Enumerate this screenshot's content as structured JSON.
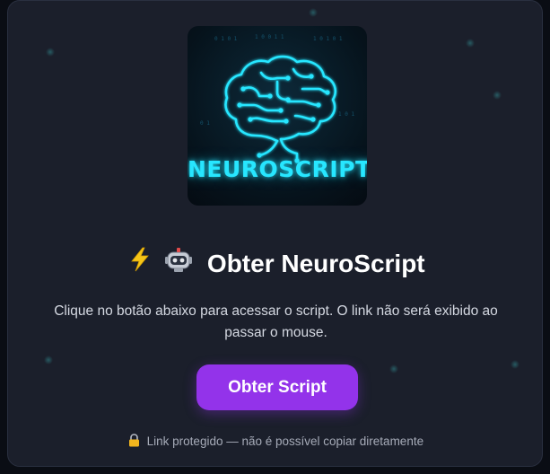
{
  "logo": {
    "text": "NEUROSCRIPT",
    "icon": "neural-brain-icon",
    "accent": "#27e6ff"
  },
  "title": {
    "emojis": [
      "lightning-icon",
      "robot-icon"
    ],
    "text": "Obter NeuroScript"
  },
  "description": "Clique no botão abaixo para acessar o script. O link não será exibido ao passar o mouse.",
  "button": {
    "label": "Obter Script",
    "color": "#9333ea"
  },
  "note": {
    "icon": "lock-icon",
    "text": "Link protegido — não é possível copiar diretamente"
  }
}
